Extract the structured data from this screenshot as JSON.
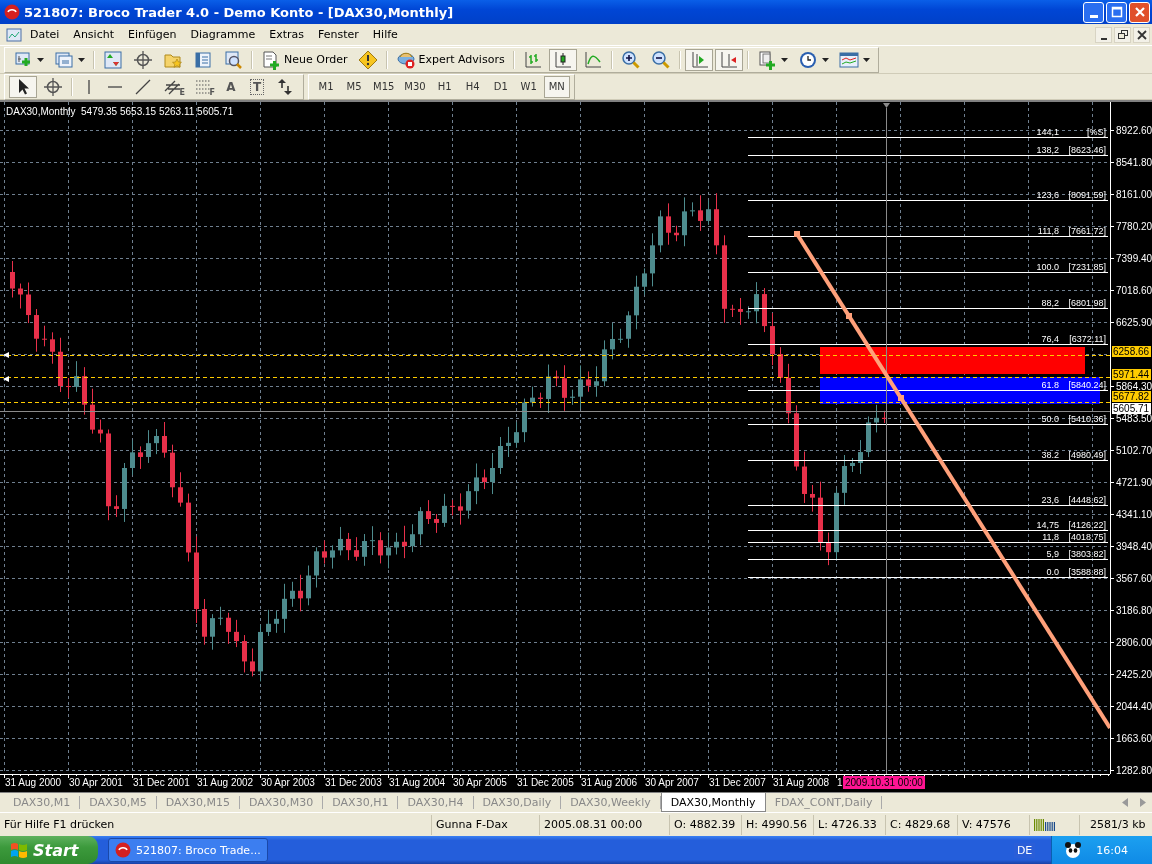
{
  "window": {
    "title": "521807: Broco Trader 4.0 - Demo Konto - [DAX30,Monthly]"
  },
  "menu": [
    "Datei",
    "Ansicht",
    "Einfügen",
    "Diagramme",
    "Extras",
    "Fenster",
    "Hilfe"
  ],
  "toolbar": [
    {
      "kind": "new_chart",
      "caret": true,
      "pressed": false
    },
    {
      "kind": "profiles",
      "caret": true,
      "pressed": false
    },
    {
      "kind": "separator"
    },
    {
      "kind": "market_watch",
      "caret": false,
      "pressed": false
    },
    {
      "kind": "crosshair",
      "caret": false,
      "pressed": false
    },
    {
      "kind": "favorites",
      "caret": false,
      "pressed": false
    },
    {
      "kind": "terminal",
      "caret": false,
      "pressed": false
    },
    {
      "kind": "tester",
      "caret": false,
      "pressed": false
    },
    {
      "kind": "separator"
    },
    {
      "kind": "order",
      "label": "Neue Order",
      "caret": false,
      "pressed": false
    },
    {
      "kind": "warning",
      "caret": false,
      "pressed": false
    },
    {
      "kind": "separator"
    },
    {
      "kind": "experts",
      "label": "Expert Advisors",
      "caret": false,
      "pressed": false
    },
    {
      "kind": "separator"
    },
    {
      "kind": "bar_chart",
      "caret": false,
      "pressed": false
    },
    {
      "kind": "candle_chart",
      "caret": false,
      "pressed": true
    },
    {
      "kind": "line_chart",
      "caret": false,
      "pressed": false
    },
    {
      "kind": "separator"
    },
    {
      "kind": "zoom_in",
      "caret": false,
      "pressed": false
    },
    {
      "kind": "zoom_out",
      "caret": false,
      "pressed": false
    },
    {
      "kind": "separator"
    },
    {
      "kind": "autoscroll",
      "caret": false,
      "pressed": true
    },
    {
      "kind": "chart_shift",
      "caret": false,
      "pressed": true
    },
    {
      "kind": "separator"
    },
    {
      "kind": "template",
      "caret": true,
      "pressed": false
    },
    {
      "kind": "clock",
      "caret": true,
      "pressed": false
    },
    {
      "kind": "indicators",
      "caret": true,
      "pressed": false
    }
  ],
  "tools": [
    {
      "kind": "cursor",
      "pressed": true
    },
    {
      "kind": "crosshair",
      "pressed": false
    },
    {
      "kind": "separator"
    },
    {
      "kind": "vline",
      "pressed": false
    },
    {
      "kind": "hline",
      "pressed": false
    },
    {
      "kind": "trendline",
      "pressed": false
    },
    {
      "kind": "channel",
      "sub": "E",
      "pressed": false
    },
    {
      "kind": "fibo",
      "sub": "F",
      "pressed": false
    },
    {
      "kind": "glyph",
      "label": "A",
      "pressed": false
    },
    {
      "kind": "label_box",
      "label": "T",
      "pressed": false
    },
    {
      "kind": "arrows",
      "pressed": false
    }
  ],
  "timeframes": [
    {
      "label": "M1",
      "selected": false
    },
    {
      "label": "M5",
      "selected": false
    },
    {
      "label": "M15",
      "selected": false
    },
    {
      "label": "M30",
      "selected": false
    },
    {
      "label": "H1",
      "selected": false
    },
    {
      "label": "H4",
      "selected": false
    },
    {
      "label": "D1",
      "selected": false
    },
    {
      "label": "W1",
      "selected": false
    },
    {
      "label": "MN",
      "selected": true
    }
  ],
  "chart": {
    "header": "DAX30,Monthly  5479.35 5653.15 5263.11 5605.71",
    "price_ticks": [
      "8922.60",
      "8541.80",
      "8161.00",
      "7780.20",
      "7399.40",
      "7018.60",
      "6625.90",
      "5864.30",
      "5483.50",
      "5102.70",
      "4721.90",
      "4341.10",
      "3948.40",
      "3567.60",
      "3186.80",
      "2806.00",
      "2425.20",
      "2044.40",
      "1663.60",
      "1282.80"
    ],
    "price_marks": [
      {
        "label": "6258.66",
        "color": "#ffcc00"
      },
      {
        "label": "5971.44",
        "color": "#ffcc00"
      },
      {
        "label": "5677.82",
        "color": "#ffcc00"
      },
      {
        "label": "5605.71",
        "color": "#ffffff"
      }
    ],
    "fib_levels": [
      {
        "level": "144,1",
        "price": "[%S]"
      },
      {
        "level": "138,2",
        "price": "[8623.46]"
      },
      {
        "level": "123,6",
        "price": "[8091.59]"
      },
      {
        "level": "111,8",
        "price": "[7661.72]"
      },
      {
        "level": "100.0",
        "price": "[7231.85]"
      },
      {
        "level": "88,2",
        "price": "[6801.98]"
      },
      {
        "level": "76,4",
        "price": "[6372.11]"
      },
      {
        "level": "61.8",
        "price": "[5840.24]"
      },
      {
        "level": "50.0",
        "price": "[5410.36]"
      },
      {
        "level": "38.2",
        "price": "[4980.49]"
      },
      {
        "level": "23,6",
        "price": "[4448.62]"
      },
      {
        "level": "14,75",
        "price": "[4126.22]"
      },
      {
        "level": "11,8",
        "price": "[4018.75]"
      },
      {
        "level": "5,9",
        "price": "[3803.82]"
      },
      {
        "level": "0.0",
        "price": "[3588.88]"
      }
    ],
    "time_ticks": [
      "31 Aug 2000",
      "30 Apr 2001",
      "31 Dec 2001",
      "31 Aug 2002",
      "30 Apr 2003",
      "31 Dec 2003",
      "31 Aug 2004",
      "30 Apr 2005",
      "31 Dec 2005",
      "31 Aug 2006",
      "30 Apr 2007",
      "31 Dec 2007",
      "31 Aug 2008",
      "1"
    ],
    "cursor_time": "2009.10.31 00:00"
  },
  "tabs": [
    {
      "label": "DAX30,M1",
      "selected": false
    },
    {
      "label": "DAX30,M5",
      "selected": false
    },
    {
      "label": "DAX30,M15",
      "selected": false
    },
    {
      "label": "DAX30,M30",
      "selected": false
    },
    {
      "label": "DAX30,H1",
      "selected": false
    },
    {
      "label": "DAX30,H4",
      "selected": false
    },
    {
      "label": "DAX30,Daily",
      "selected": false
    },
    {
      "label": "DAX30,Weekly",
      "selected": false
    },
    {
      "label": "DAX30,Monthly",
      "selected": true
    },
    {
      "label": "FDAX_CONT,Daily",
      "selected": false
    }
  ],
  "status_bar": {
    "help": "Für Hilfe F1 drücken",
    "profile": "Gunna F-Dax",
    "time": "2005.08.31 00:00",
    "open": "O: 4882.39",
    "high": "H: 4990.56",
    "low": "L: 4726.33",
    "close": "C: 4829.68",
    "volume": "V: 47576",
    "traffic": "2581/3 kb"
  },
  "taskbar": {
    "start": "Start",
    "task": "521807: Broco Trade...",
    "language": "DE",
    "clock": "16:04"
  }
}
